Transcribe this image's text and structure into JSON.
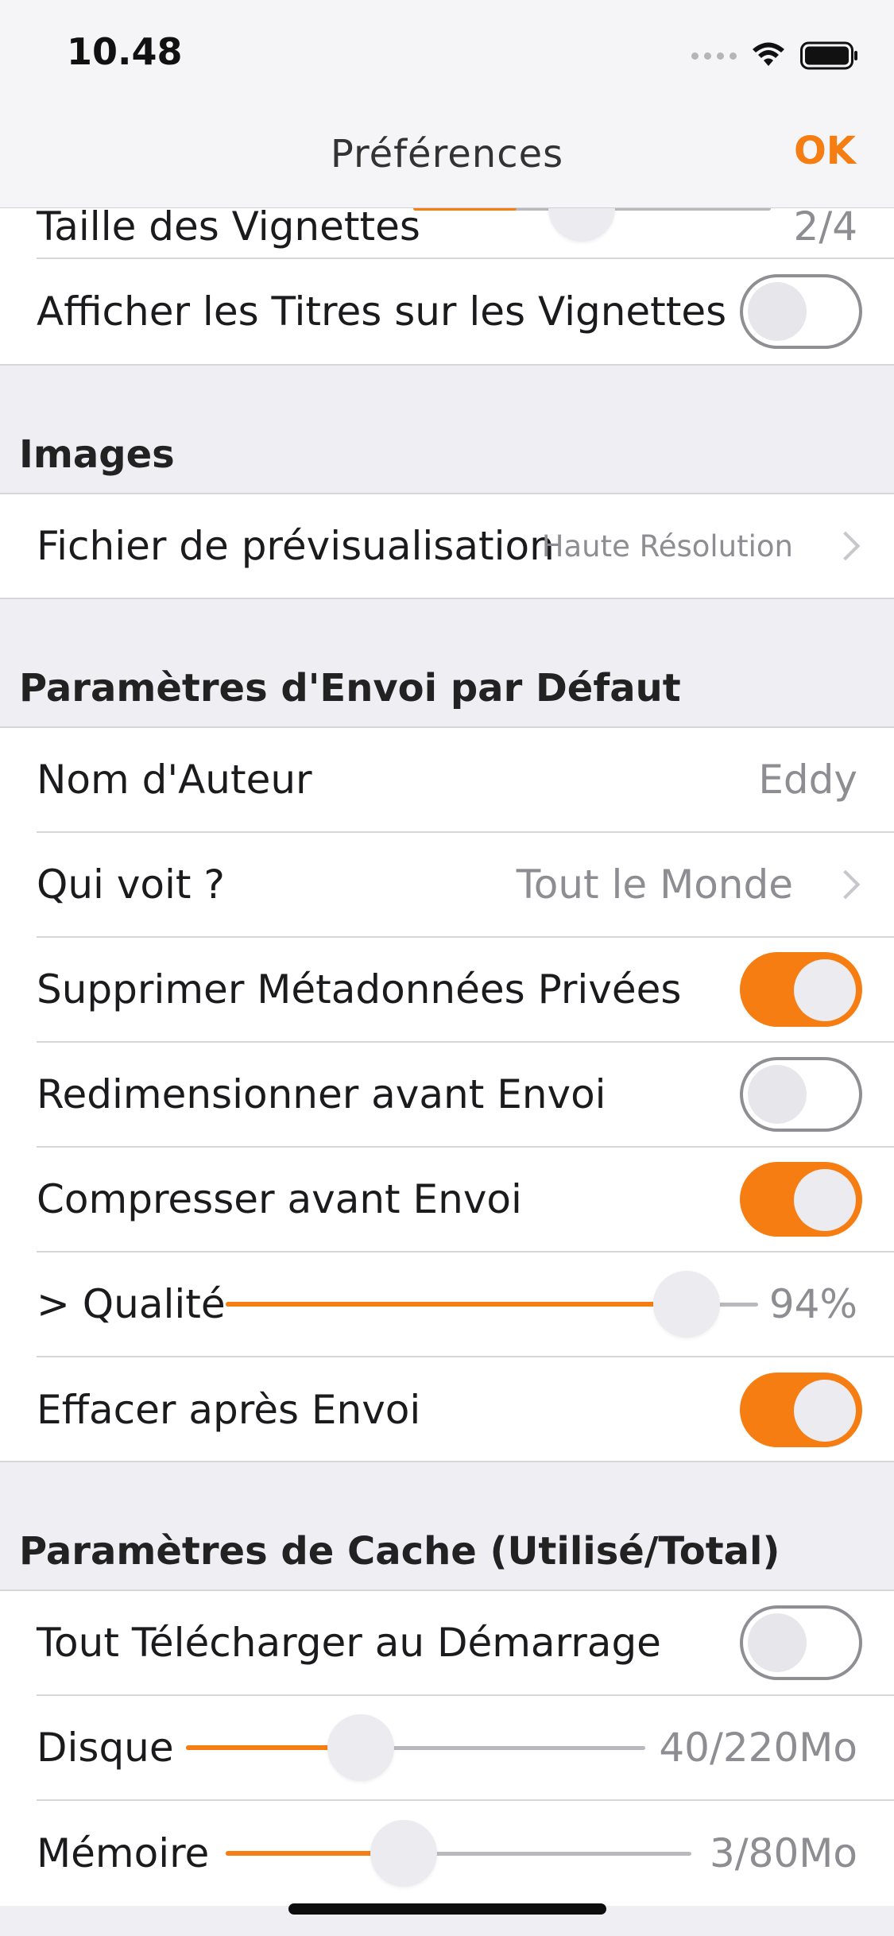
{
  "status": {
    "time": "10.48"
  },
  "nav": {
    "title": "Préférences",
    "ok_label": "OK"
  },
  "top_group": {
    "thumb_size": {
      "label": "Taille des Vignettes",
      "value": "2/4",
      "level": 0.45
    },
    "titles_on_thumbs": {
      "label": "Afficher les Titres sur les Vignettes",
      "on": false
    }
  },
  "images": {
    "header": "Images",
    "preview_file": {
      "label": "Fichier de prévisualisation",
      "value": "Haute Résolution"
    }
  },
  "upload": {
    "header": "Paramètres d'Envoi par Défaut",
    "author": {
      "label": "Nom d'Auteur",
      "value": "Eddy"
    },
    "who_sees": {
      "label": "Qui voit ?",
      "value": "Tout le Monde"
    },
    "strip_metadata": {
      "label": "Supprimer Métadonnées Privées",
      "on": true
    },
    "resize": {
      "label": "Redimensionner avant Envoi",
      "on": false
    },
    "compress": {
      "label": "Compresser avant Envoi",
      "on": true
    },
    "quality": {
      "label": "> Qualité",
      "value": "94%",
      "level": 0.94
    },
    "delete_after": {
      "label": "Effacer après Envoi",
      "on": true
    }
  },
  "cache": {
    "header": "Paramètres de Cache (Utilisé/Total)",
    "download_all": {
      "label": "Tout Télécharger au Démarrage",
      "on": false
    },
    "disk": {
      "label": "Disque",
      "value": "40/220Mo",
      "level": 0.4
    },
    "memory": {
      "label": "Mémoire",
      "value": "3/80Mo",
      "level": 0.38
    }
  },
  "colors": {
    "accent": "#f57d12",
    "background": "#eeeef3",
    "cell": "#ffffff",
    "secondary_text": "#8d8d92"
  }
}
